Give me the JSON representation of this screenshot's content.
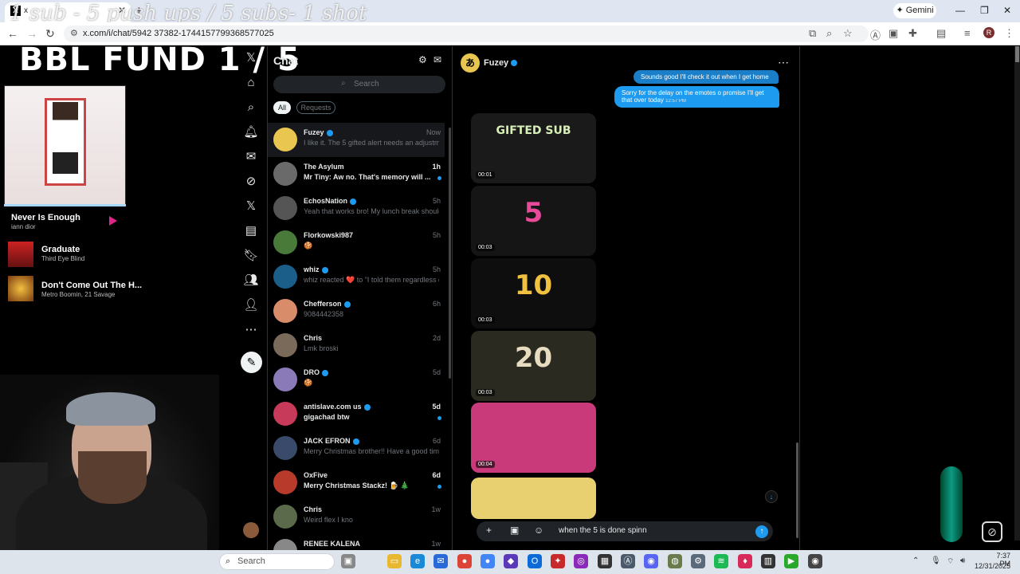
{
  "browser": {
    "tab_title": "x",
    "overlay_title": "1 sub - 5 push ups / 5 subs- 1 shot",
    "gemini_label": "Gemini",
    "url": "x.com/i/chat/5942 37382-1744157799368577025",
    "profile_initial": "R"
  },
  "stream_overlay": {
    "headline": "BBL FUND  1 / 5",
    "now_playing": {
      "title": "Never Is Enough",
      "artist": "iann dior"
    },
    "queue": [
      {
        "title": "Graduate",
        "artist": "Third Eye Blind"
      },
      {
        "title": "Don't Come Out The H...",
        "artist": "Metro Boomin, 21 Savage"
      }
    ]
  },
  "chat": {
    "title": "Chat",
    "search_placeholder": "Search",
    "filters": {
      "all": "All",
      "requests": "Requests"
    },
    "conversations": [
      {
        "name": "Fuzey",
        "verified": true,
        "time": "Now",
        "preview": "I like it. The 5 gifted alert needs an adjustme...",
        "unread": false,
        "selected": true,
        "avatar_color": "#e8c64f"
      },
      {
        "name": "The Asylum",
        "verified": false,
        "time": "1h",
        "preview": "Mr Tiny: Aw no. That's memory will ...",
        "unread": true,
        "selected": false,
        "avatar_color": "#6a6a6a"
      },
      {
        "name": "EchosNation",
        "verified": true,
        "time": "5h",
        "preview": "Yeah that works bro! My lunch break should ...",
        "unread": false,
        "selected": false,
        "avatar_color": "#555"
      },
      {
        "name": "Florkowski987",
        "verified": false,
        "time": "5h",
        "preview": "🍪",
        "unread": false,
        "selected": false,
        "avatar_color": "#4a7a3a"
      },
      {
        "name": "whiz",
        "verified": true,
        "time": "5h",
        "preview": "whiz reacted ❤️ to \"I told them regardless of ...",
        "unread": false,
        "selected": false,
        "avatar_color": "#1b5e8a"
      },
      {
        "name": "Chefferson",
        "verified": true,
        "time": "6h",
        "preview": "9084442358",
        "unread": false,
        "selected": false,
        "avatar_color": "#d98c6a"
      },
      {
        "name": "Chris",
        "verified": false,
        "time": "2d",
        "preview": "Lmk broski",
        "unread": false,
        "selected": false,
        "avatar_color": "#7a6a5a"
      },
      {
        "name": "DRO",
        "verified": true,
        "time": "5d",
        "preview": "🍪",
        "unread": false,
        "selected": false,
        "avatar_color": "#8a7ab8"
      },
      {
        "name": "antislave.com us",
        "verified": true,
        "time": "5d",
        "preview": "gigachad btw",
        "unread": true,
        "selected": false,
        "avatar_color": "#c83a5a"
      },
      {
        "name": "JACK EFRON",
        "verified": true,
        "time": "6d",
        "preview": "Merry Christmas brother!! Have a good time ...",
        "unread": false,
        "selected": false,
        "avatar_color": "#3a4a6a"
      },
      {
        "name": "OxFive",
        "verified": false,
        "time": "6d",
        "preview": "Merry Christmas Stackz! 🍺 🎄",
        "unread": true,
        "selected": false,
        "avatar_color": "#b83a2a"
      },
      {
        "name": "Chris",
        "verified": false,
        "time": "1w",
        "preview": "Weird flex I kno",
        "unread": false,
        "selected": false,
        "avatar_color": "#5a6a4a"
      },
      {
        "name": "RENEE KALENA",
        "verified": false,
        "time": "1w",
        "preview": "",
        "unread": false,
        "selected": false,
        "avatar_color": "#888"
      }
    ]
  },
  "conversation": {
    "contact_name": "Fuzey",
    "contact_avatar_glyph": "あ",
    "messages": [
      {
        "text": "Sounds good I'll check it out when I get home"
      },
      {
        "text": "Sorry for the delay on the emotes o promise I'll get that over today",
        "time": "12:57 PM"
      }
    ],
    "media": [
      {
        "duration": "00:01",
        "art_text": "GIFTED SUB",
        "bg": "#1a1a1a",
        "color": "#d8f0b8"
      },
      {
        "duration": "00:03",
        "art_text": "5",
        "bg": "#151515",
        "color": "#e84a9a"
      },
      {
        "duration": "00:03",
        "art_text": "10",
        "bg": "#0e0e0e",
        "color": "#f0c040"
      },
      {
        "duration": "00:03",
        "art_text": "20",
        "bg": "#2a2a20",
        "color": "#e8dcc0"
      },
      {
        "duration": "00:04",
        "art_text": "",
        "bg": "#c83a7a",
        "color": "#ffffff"
      },
      {
        "duration": "",
        "art_text": "",
        "bg": "#e8d070",
        "color": "#ffffff"
      }
    ],
    "composer_text": "when the 5 is done spinn"
  },
  "taskbar": {
    "search_label": "Search",
    "time": "7:37 PM",
    "date": "12/31/2025"
  },
  "colors": {
    "accent": "#1d9bf0",
    "background": "#000000",
    "muted_text": "#71767b"
  }
}
